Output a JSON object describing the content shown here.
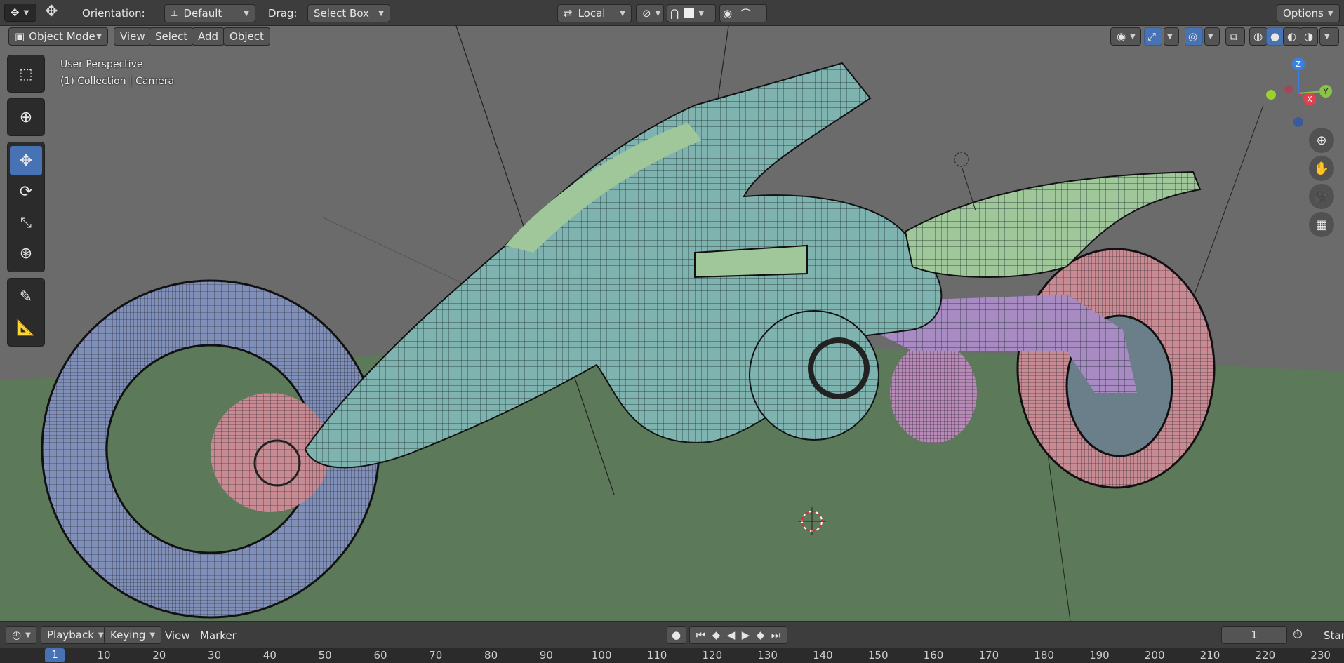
{
  "topbar": {
    "orientation_label": "Orientation:",
    "orientation_value": "Default",
    "drag_label": "Drag:",
    "drag_value": "Select Box",
    "pivot_value": "Local",
    "options_label": "Options"
  },
  "header": {
    "mode": "Object Mode",
    "menus": [
      "View",
      "Select",
      "Add",
      "Object"
    ]
  },
  "viewport": {
    "info_line1": "User Perspective",
    "info_line2": "(1) Collection | Camera"
  },
  "gizmo": {
    "z": "Z",
    "y": "Y",
    "x": "X"
  },
  "timeline": {
    "menus": [
      "Playback",
      "Keying",
      "View",
      "Marker"
    ],
    "current_frame": "1",
    "start_label": "Star"
  },
  "ruler": {
    "current": "1",
    "ticks": [
      "10",
      "20",
      "30",
      "40",
      "50",
      "60",
      "70",
      "80",
      "90",
      "100",
      "110",
      "120",
      "130",
      "140",
      "150",
      "160",
      "170",
      "180",
      "190",
      "200",
      "210",
      "220",
      "230"
    ]
  },
  "colors": {
    "accent": "#4772b3",
    "floor": "#5c7a5a",
    "body": "#7fb3b0",
    "front_wheel": "#7f8fb8",
    "rear_wheel": "#c98b93",
    "fender": "#9fc79a",
    "frame": "#a98bc4"
  }
}
